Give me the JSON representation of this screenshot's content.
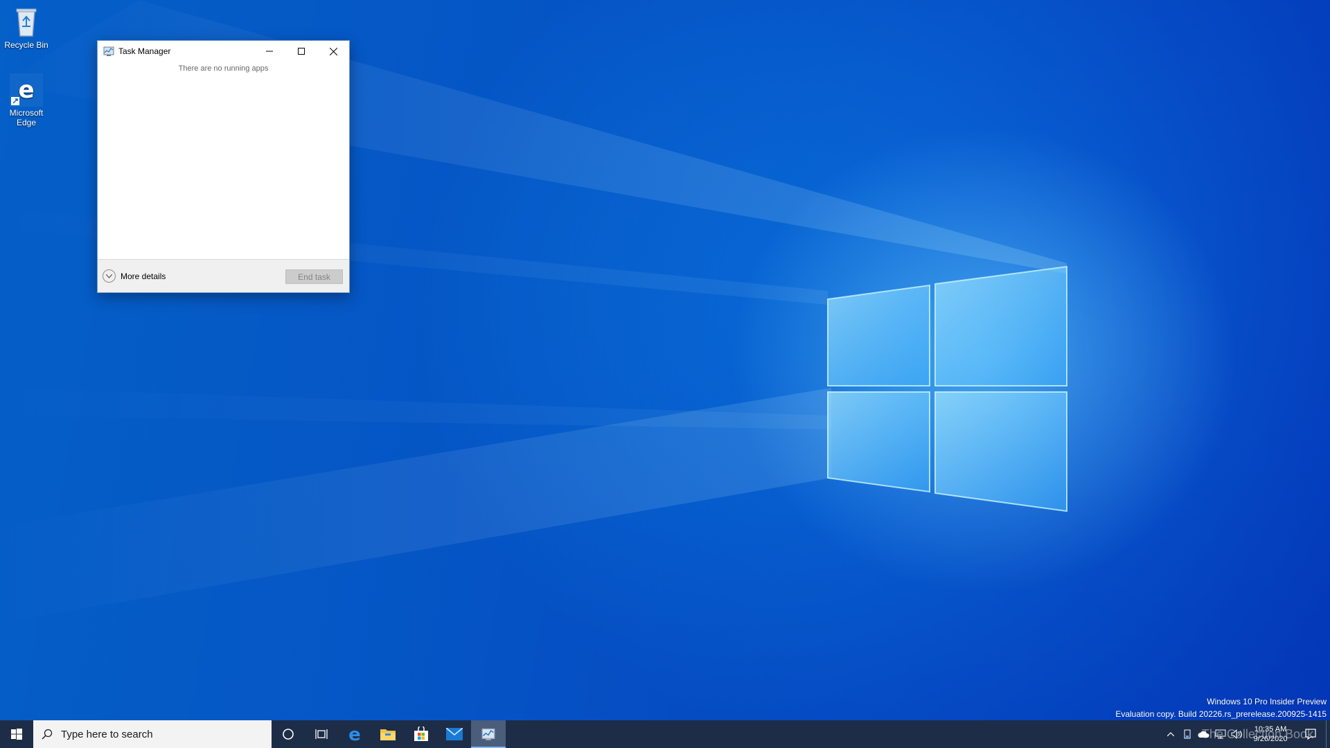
{
  "desktop": {
    "icons": [
      {
        "label": "Recycle Bin"
      },
      {
        "label": "Microsoft Edge"
      }
    ]
  },
  "task_manager": {
    "title": "Task Manager",
    "empty_message": "There are no running apps",
    "more_details_label": "More details",
    "end_task_label": "End task"
  },
  "watermark": {
    "line1": "Windows 10 Pro Insider Preview",
    "line2": "Evaluation copy. Build 20226.rs_prerelease.200925-1415"
  },
  "taskbar": {
    "search_placeholder": "Type here to search",
    "pinned": [
      "start-icon",
      "cortana-icon",
      "task-view-icon",
      "edge-icon",
      "file-explorer-icon",
      "store-icon",
      "mail-icon",
      "task-manager-icon"
    ],
    "clock_time": "10:35 AM",
    "clock_date": "9/26/2020",
    "corner_logo_text": "The Collection Book"
  },
  "colors": {
    "taskbar_bg": "#1d2d47",
    "accent": "#0078d7",
    "end_task_disabled_bg": "#cccccc"
  }
}
